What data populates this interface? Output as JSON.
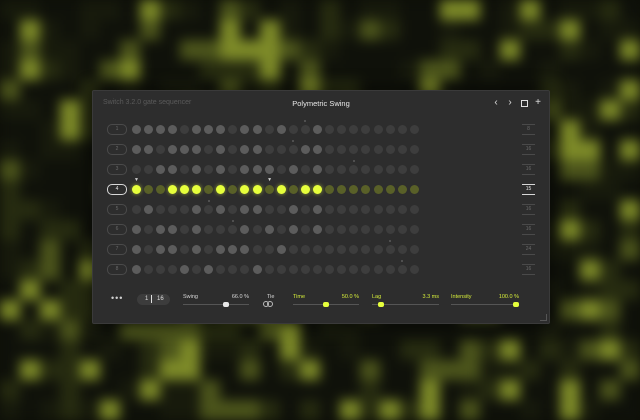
{
  "app": {
    "title": "Switch 3.2.0 gate sequencer"
  },
  "header": {
    "preset_name": "Polymetric Swing",
    "prev_icon": "chevron-left-icon",
    "next_icon": "chevron-right-icon",
    "window_icon": "square-icon",
    "add_icon": "plus-icon"
  },
  "rows": [
    {
      "label": "1",
      "length": "8",
      "active": false
    },
    {
      "label": "2",
      "length": "16",
      "active": false
    },
    {
      "label": "3",
      "length": "16",
      "active": false
    },
    {
      "label": "4",
      "length": "15",
      "active": true
    },
    {
      "label": "5",
      "length": "16",
      "active": false
    },
    {
      "label": "6",
      "length": "16",
      "active": false
    },
    {
      "label": "7",
      "length": "24",
      "active": false
    },
    {
      "label": "8",
      "length": "16",
      "active": false
    }
  ],
  "grid": [
    "2222022202202002",
    "2202220202200022",
    "0022020202220202",
    "3003330303303033",
    "0200020202200202",
    "2022020002020202",
    "2022020222002000",
    "2000202000200000"
  ],
  "footer": {
    "more_label": "•••",
    "page_current": "1",
    "page_total": "16",
    "swing": {
      "label": "Swing",
      "value": "66.0 %",
      "level": 0.66
    },
    "tie": {
      "label": "Tie"
    },
    "time": {
      "label": "Time",
      "value": "50.0 %",
      "level": 0.5
    },
    "lag": {
      "label": "Lag",
      "value": "3.3 ms",
      "level": 0.1
    },
    "intensity": {
      "label": "Intensity",
      "value": "100.0 %",
      "level": 1.0
    }
  },
  "colors": {
    "accent": "#e6ff3c",
    "accent_text": "#d6ee3a",
    "panel": "#2d2d2d",
    "step_off": "#3d3d3d",
    "step_on": "#5c5c5c"
  }
}
